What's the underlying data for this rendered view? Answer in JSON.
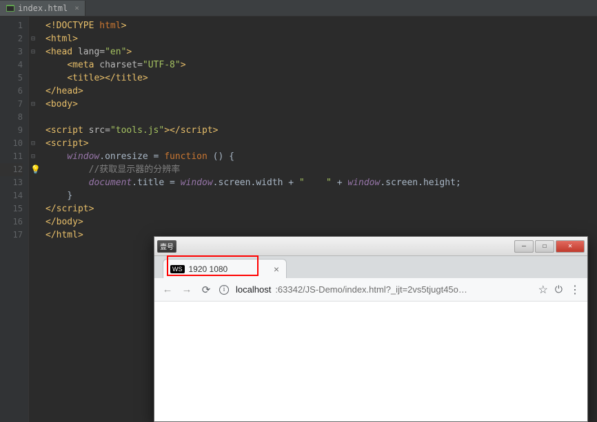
{
  "tab": {
    "filename": "index.html",
    "close": "×"
  },
  "gutter": [
    "1",
    "2",
    "3",
    "4",
    "5",
    "6",
    "7",
    "8",
    "9",
    "10",
    "11",
    "12",
    "13",
    "14",
    "15",
    "16",
    "17"
  ],
  "code": {
    "l1": {
      "a": "<!DOCTYPE ",
      "b": "html",
      "c": ">"
    },
    "l2": {
      "a": "<html>"
    },
    "l3": {
      "a": "<head ",
      "b": "lang=",
      "c": "\"en\"",
      "d": ">"
    },
    "l4": {
      "a": "<meta ",
      "b": "charset=",
      "c": "\"UTF-8\"",
      "d": ">"
    },
    "l5": {
      "a": "<title></title>"
    },
    "l6": {
      "a": "</head>"
    },
    "l7": {
      "a": "<body>"
    },
    "l8": "",
    "l9": {
      "a": "<script ",
      "b": "src=",
      "c": "\"tools.js\"",
      "d": "></script",
      "e": ">"
    },
    "l10": {
      "a": "<script>"
    },
    "l11": {
      "a": "window",
      "b": ".onresize = ",
      "c": "function ",
      "d": "() {"
    },
    "l12": {
      "a": "//获取显示器的分辨率"
    },
    "l13": {
      "a": "document",
      "b": ".title = ",
      "c": "window",
      "d": ".screen.width + ",
      "e": "\"    \"",
      "f": " + ",
      "g": "window",
      "h": ".screen.height;"
    },
    "l14": {
      "a": "}"
    },
    "l15": {
      "a": "</script",
      "b": ">"
    },
    "l16": {
      "a": "</body>"
    },
    "l17": {
      "a": "</html>"
    }
  },
  "browser": {
    "language_btn": "壹号",
    "tab_title": "1920 1080",
    "tab_badge": "WS",
    "url_host": "localhost",
    "url_port": ":63342/JS-Demo/index.html?_ijt=2vs5tjugt45o…"
  }
}
